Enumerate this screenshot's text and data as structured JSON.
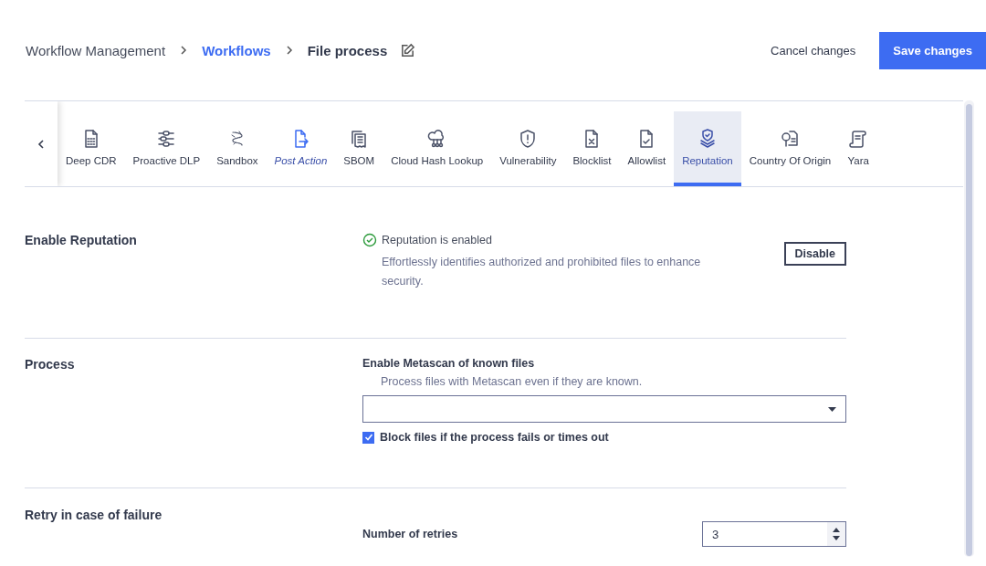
{
  "breadcrumb": [
    {
      "label": "Workflow Management",
      "kind": "plain"
    },
    {
      "label": "Workflows",
      "kind": "link"
    },
    {
      "label": "File process",
      "kind": "current"
    }
  ],
  "actions": {
    "cancel": "Cancel changes",
    "save": "Save changes"
  },
  "tabs": [
    {
      "label": "Deep CDR",
      "selected": false,
      "highlighted": false
    },
    {
      "label": "Proactive DLP",
      "selected": false,
      "highlighted": false
    },
    {
      "label": "Sandbox",
      "selected": false,
      "highlighted": false
    },
    {
      "label": "Post Action",
      "selected": false,
      "highlighted": true
    },
    {
      "label": "SBOM",
      "selected": false,
      "highlighted": false
    },
    {
      "label": "Cloud Hash Lookup",
      "selected": false,
      "highlighted": false
    },
    {
      "label": "Vulnerability",
      "selected": false,
      "highlighted": false
    },
    {
      "label": "Blocklist",
      "selected": false,
      "highlighted": false
    },
    {
      "label": "Allowlist",
      "selected": false,
      "highlighted": false
    },
    {
      "label": "Reputation",
      "selected": true,
      "highlighted": false
    },
    {
      "label": "Country Of Origin",
      "selected": false,
      "highlighted": false
    },
    {
      "label": "Yara",
      "selected": false,
      "highlighted": false
    }
  ],
  "enable": {
    "title": "Enable Reputation",
    "status": "Reputation is enabled",
    "description": "Effortlessly identifies authorized and prohibited files to enhance security.",
    "button": "Disable"
  },
  "process": {
    "title": "Process",
    "field_label": "Enable Metascan of known files",
    "hint": "Process files with Metascan even if they are known.",
    "checkbox": {
      "label": "Block files if the process fails or times out",
      "checked": true
    }
  },
  "retry": {
    "title": "Retry in case of failure",
    "field_label": "Number of retries",
    "value": "3"
  }
}
